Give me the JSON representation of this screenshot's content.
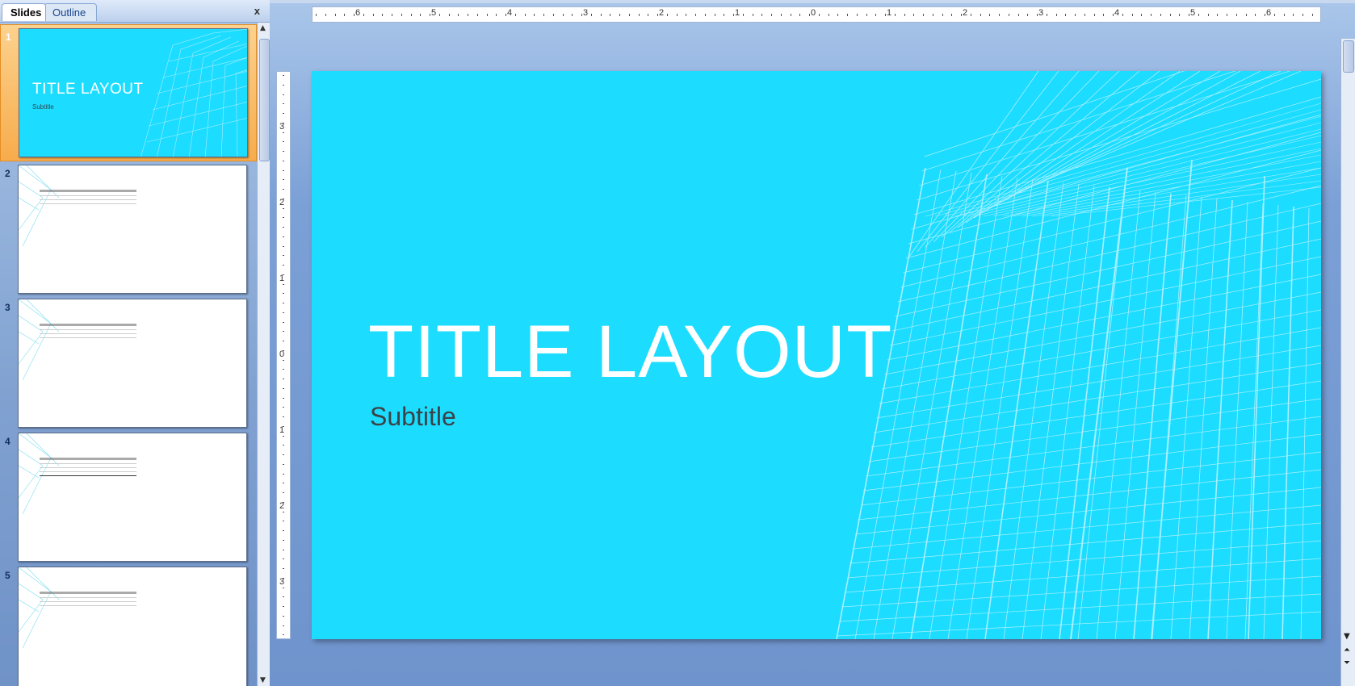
{
  "panel": {
    "tabs": [
      {
        "label": "Slides"
      },
      {
        "label": "Outline"
      }
    ],
    "close_glyph": "x"
  },
  "thumbnails": [
    {
      "number": "1",
      "title": "TITLE LAYOUT",
      "subtitle": "Subtitle",
      "selected": true
    },
    {
      "number": "2",
      "selected": false
    },
    {
      "number": "3",
      "selected": false
    },
    {
      "number": "4",
      "selected": false
    },
    {
      "number": "5",
      "selected": false
    }
  ],
  "ruler": {
    "horizontal_labels": [
      "6",
      "5",
      "4",
      "3",
      "2",
      "1",
      "0",
      "1",
      "2",
      "3",
      "4",
      "5",
      "6"
    ],
    "vertical_labels": [
      "3",
      "2",
      "1",
      "0",
      "1",
      "2",
      "3"
    ]
  },
  "slide": {
    "title": "TITLE LAYOUT",
    "subtitle": "Subtitle",
    "background_color": "#1cdcff"
  },
  "colors": {
    "accent_selected": "#f7ac4c",
    "slide_cyan": "#1cdcff",
    "workspace_blue": "#6f93cc"
  }
}
